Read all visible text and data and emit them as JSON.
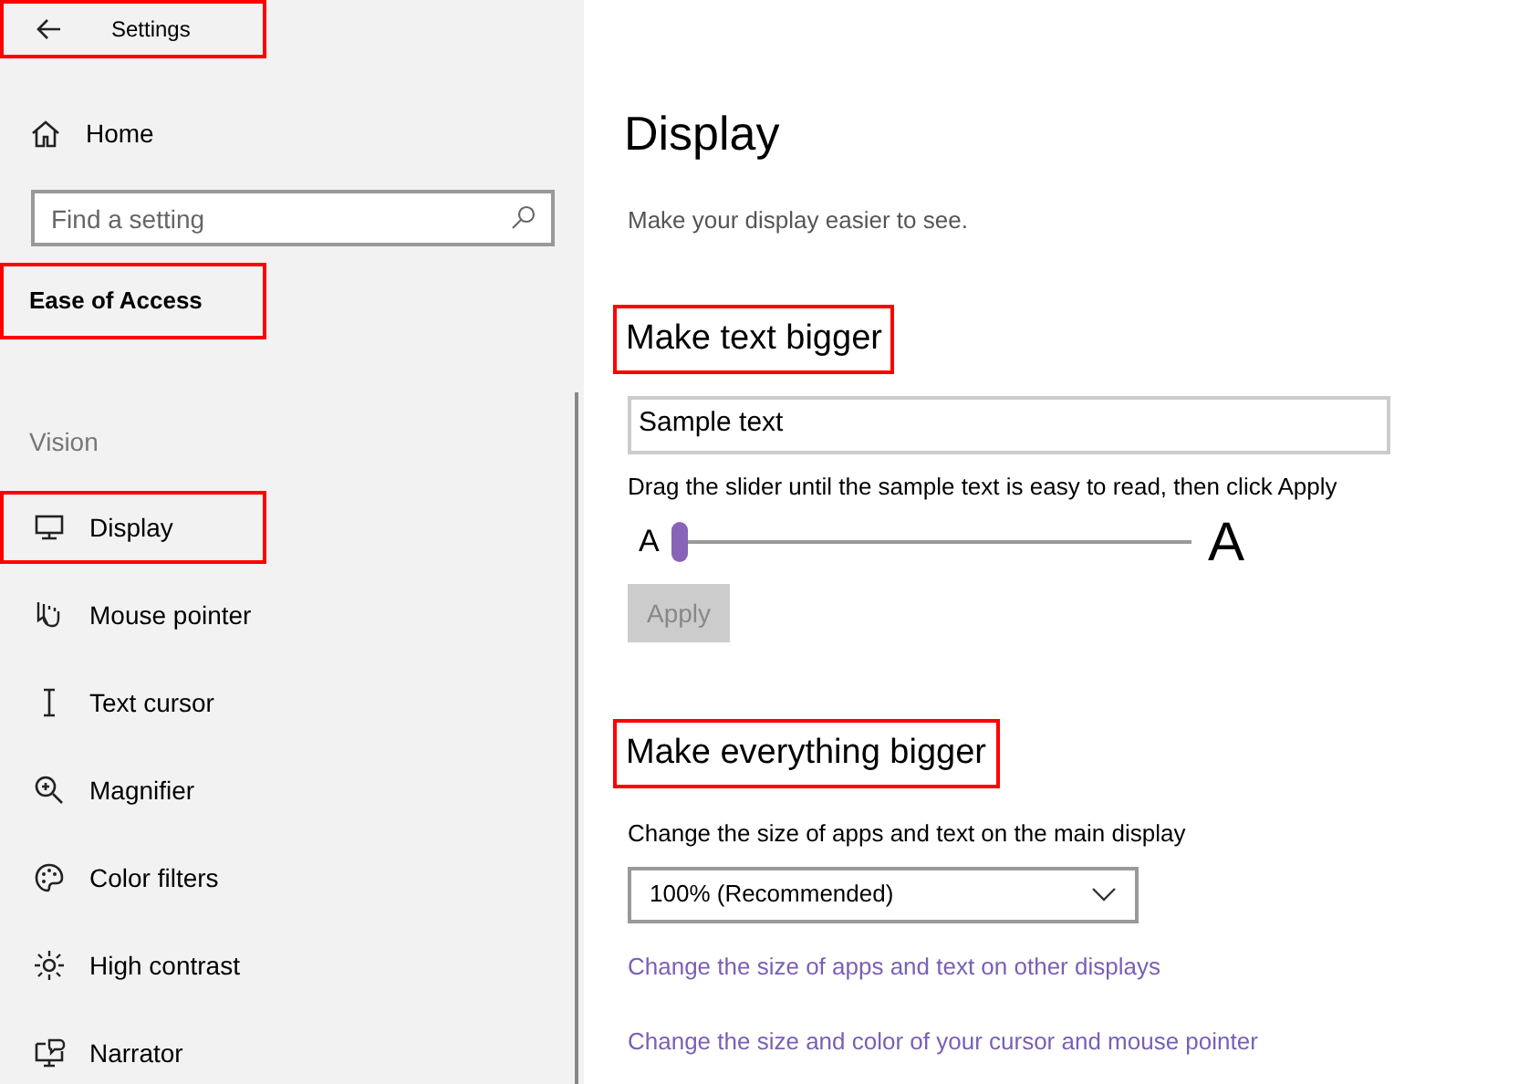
{
  "header": {
    "title": "Settings",
    "highlighted": true
  },
  "sidebar": {
    "home": "Home",
    "search": {
      "placeholder": "Find a setting"
    },
    "category": {
      "label": "Ease of Access",
      "highlighted": true
    },
    "group": "Vision",
    "items": [
      {
        "label": "Display",
        "selected": false,
        "highlighted": true
      },
      {
        "label": "Mouse pointer",
        "selected": false,
        "highlighted": false
      },
      {
        "label": "Text cursor",
        "selected": false,
        "highlighted": false
      },
      {
        "label": "Magnifier",
        "selected": false,
        "highlighted": false
      },
      {
        "label": "Color filters",
        "selected": false,
        "highlighted": false
      },
      {
        "label": "High contrast",
        "selected": false,
        "highlighted": false
      },
      {
        "label": "Narrator",
        "selected": false,
        "highlighted": false
      }
    ]
  },
  "main": {
    "title": "Display",
    "subtitle": "Make your display easier to see.",
    "text_section": {
      "heading": "Make text bigger",
      "highlighted": true,
      "sample": "Sample text",
      "instruction": "Drag the slider until the sample text is easy to read, then click Apply",
      "small_a": "A",
      "large_a": "A",
      "slider": {
        "level": 0
      },
      "apply": {
        "label": "Apply",
        "disabled": true
      }
    },
    "everything_section": {
      "heading": "Make everything bigger",
      "highlighted": true,
      "label": "Change the size of apps and text on the main display",
      "dropdown": "100% (Recommended)"
    },
    "links": [
      "Change the size of apps and text on other displays",
      "Change the size and color of your cursor and mouse pointer"
    ]
  }
}
